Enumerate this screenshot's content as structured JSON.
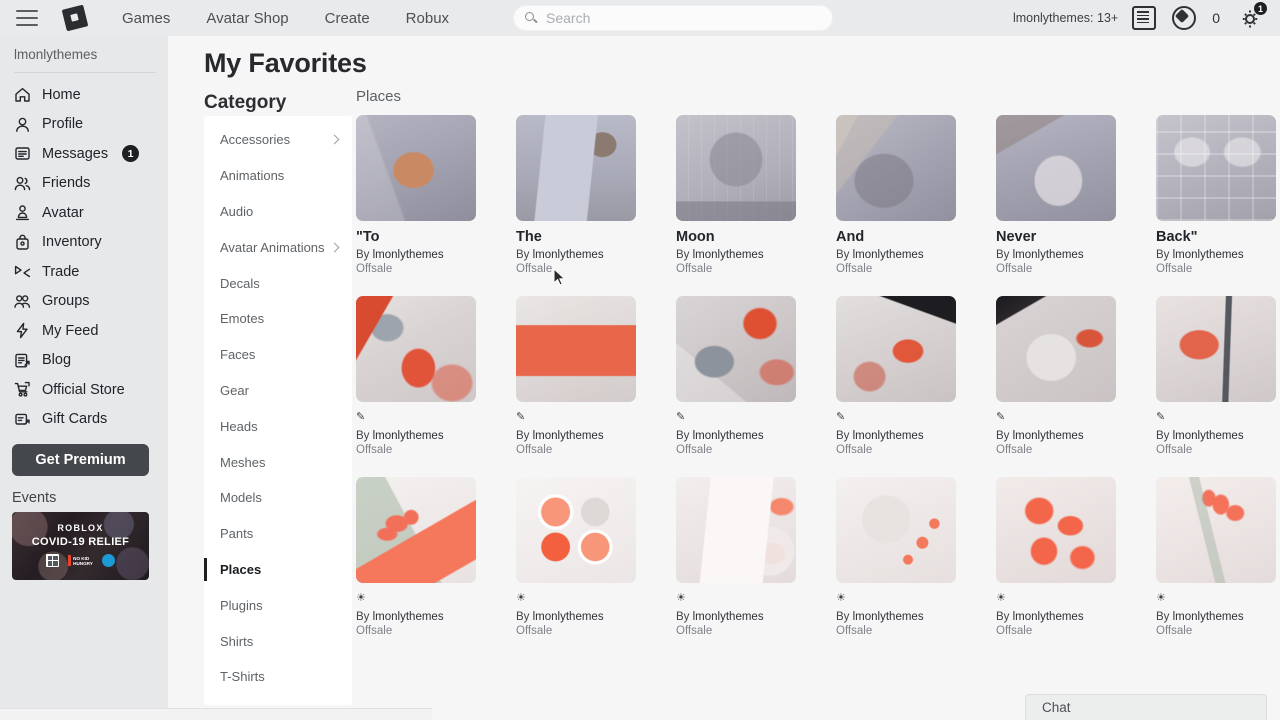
{
  "topnav": {
    "menu_icon": "hamburger-menu-icon",
    "logo_icon": "roblox-logo-icon",
    "links": [
      {
        "label": "Games"
      },
      {
        "label": "Avatar Shop"
      },
      {
        "label": "Create"
      },
      {
        "label": "Robux"
      }
    ],
    "search": {
      "placeholder": "Search",
      "value": "",
      "icon": "search-icon"
    },
    "age_label": "lmonlythemes: 13+",
    "feed_icon": "feed-list-icon",
    "robux_icon": "robux-icon",
    "robux_count": "0",
    "gear_icon": "gear-icon",
    "gear_badge": "1"
  },
  "sidebar": {
    "username": "lmonlythemes",
    "items": [
      {
        "label": "Home",
        "icon": "home-icon",
        "badge": ""
      },
      {
        "label": "Profile",
        "icon": "profile-icon",
        "badge": ""
      },
      {
        "label": "Messages",
        "icon": "messages-icon",
        "badge": "1"
      },
      {
        "label": "Friends",
        "icon": "friends-icon",
        "badge": ""
      },
      {
        "label": "Avatar",
        "icon": "avatar-icon",
        "badge": ""
      },
      {
        "label": "Inventory",
        "icon": "inventory-icon",
        "badge": ""
      },
      {
        "label": "Trade",
        "icon": "trade-icon",
        "badge": ""
      },
      {
        "label": "Groups",
        "icon": "groups-icon",
        "badge": ""
      },
      {
        "label": "My Feed",
        "icon": "my-feed-icon",
        "badge": ""
      },
      {
        "label": "Blog",
        "icon": "blog-icon",
        "badge": ""
      },
      {
        "label": "Official Store",
        "icon": "official-store-icon",
        "badge": ""
      },
      {
        "label": "Gift Cards",
        "icon": "gift-cards-icon",
        "badge": ""
      }
    ],
    "premium_label": "Get Premium",
    "events_title": "Events",
    "events_banner": {
      "brand": "ROBLOX",
      "title": "COVID-19 RELIEF",
      "partner_1": "gates-foundation-logo",
      "partner_2_line1": "NO KID",
      "partner_2_line2": "HUNGRY",
      "partner_3": "unicef-logo"
    }
  },
  "main": {
    "page_title": "My Favorites",
    "category_title": "Category",
    "section_label": "Places",
    "categories": [
      {
        "label": "Accessories",
        "expandable": true,
        "active": false
      },
      {
        "label": "Animations",
        "expandable": false,
        "active": false
      },
      {
        "label": "Audio",
        "expandable": false,
        "active": false
      },
      {
        "label": "Avatar Animations",
        "expandable": true,
        "active": false
      },
      {
        "label": "Decals",
        "expandable": false,
        "active": false
      },
      {
        "label": "Emotes",
        "expandable": false,
        "active": false
      },
      {
        "label": "Faces",
        "expandable": false,
        "active": false
      },
      {
        "label": "Gear",
        "expandable": false,
        "active": false
      },
      {
        "label": "Heads",
        "expandable": false,
        "active": false
      },
      {
        "label": "Meshes",
        "expandable": false,
        "active": false
      },
      {
        "label": "Models",
        "expandable": false,
        "active": false
      },
      {
        "label": "Pants",
        "expandable": false,
        "active": false
      },
      {
        "label": "Places",
        "expandable": false,
        "active": true
      },
      {
        "label": "Plugins",
        "expandable": false,
        "active": false
      },
      {
        "label": "Shirts",
        "expandable": false,
        "active": false
      },
      {
        "label": "T-Shirts",
        "expandable": false,
        "active": false
      }
    ],
    "by_prefix": "By",
    "rows": [
      {
        "items": [
          {
            "title": "\"To",
            "creator": "lmonlythemes",
            "price": "Offsale",
            "thumb": "r1a"
          },
          {
            "title": "The",
            "creator": "lmonlythemes",
            "price": "Offsale",
            "thumb": "r1b"
          },
          {
            "title": "Moon",
            "creator": "lmonlythemes",
            "price": "Offsale",
            "thumb": "r1c"
          },
          {
            "title": "And",
            "creator": "lmonlythemes",
            "price": "Offsale",
            "thumb": "r1d"
          },
          {
            "title": "Never",
            "creator": "lmonlythemes",
            "price": "Offsale",
            "thumb": "r1e"
          },
          {
            "title": "Back\"",
            "creator": "lmonlythemes",
            "price": "Offsale",
            "thumb": "r1f"
          }
        ]
      },
      {
        "items": [
          {
            "title": "✎",
            "creator": "lmonlythemes",
            "price": "Offsale",
            "thumb": "r2a"
          },
          {
            "title": "✎",
            "creator": "lmonlythemes",
            "price": "Offsale",
            "thumb": "r2b"
          },
          {
            "title": "✎",
            "creator": "lmonlythemes",
            "price": "Offsale",
            "thumb": "r2c"
          },
          {
            "title": "✎",
            "creator": "lmonlythemes",
            "price": "Offsale",
            "thumb": "r2d"
          },
          {
            "title": "✎",
            "creator": "lmonlythemes",
            "price": "Offsale",
            "thumb": "r2e"
          },
          {
            "title": "✎",
            "creator": "lmonlythemes",
            "price": "Offsale",
            "thumb": "r2f"
          }
        ]
      },
      {
        "items": [
          {
            "title": "☀",
            "creator": "lmonlythemes",
            "price": "Offsale",
            "thumb": "r3a"
          },
          {
            "title": "☀",
            "creator": "lmonlythemes",
            "price": "Offsale",
            "thumb": "r3b"
          },
          {
            "title": "☀",
            "creator": "lmonlythemes",
            "price": "Offsale",
            "thumb": "r3c"
          },
          {
            "title": "☀",
            "creator": "lmonlythemes",
            "price": "Offsale",
            "thumb": "r3d"
          },
          {
            "title": "☀",
            "creator": "lmonlythemes",
            "price": "Offsale",
            "thumb": "r3e"
          },
          {
            "title": "☀",
            "creator": "lmonlythemes",
            "price": "Offsale",
            "thumb": "r3f"
          }
        ]
      }
    ]
  },
  "chat": {
    "label": "Chat"
  },
  "colors": {
    "accent": "#1d2023",
    "page_bg": "#f6f6f7",
    "nav_bg": "#e9eaeb",
    "sidebar_bg": "#e7e8ea"
  }
}
